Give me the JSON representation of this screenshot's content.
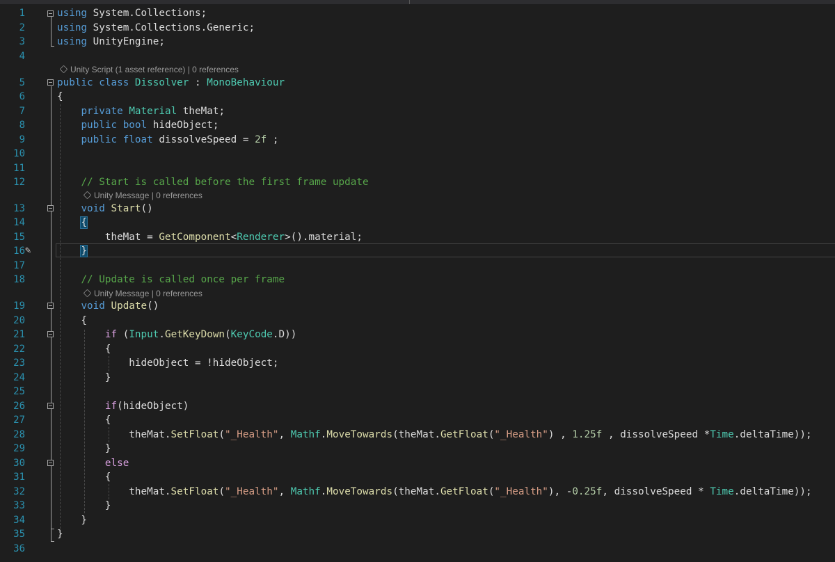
{
  "line_numbers": [
    "1",
    "2",
    "3",
    "4",
    "5",
    "6",
    "7",
    "8",
    "9",
    "10",
    "11",
    "12",
    "13",
    "14",
    "15",
    "16",
    "17",
    "18",
    "19",
    "20",
    "21",
    "22",
    "23",
    "24",
    "25",
    "26",
    "27",
    "28",
    "29",
    "30",
    "31",
    "32",
    "33",
    "34",
    "35",
    "36"
  ],
  "code_lens": {
    "class": "Unity Script (1 asset reference) | 0 references",
    "start": "Unity Message | 0 references",
    "update": "Unity Message | 0 references"
  },
  "current_line": "16",
  "colors": {
    "background": "#1e1e1e",
    "keyword": "#569cd6",
    "control_keyword": "#d8a0df",
    "type": "#4ec9b0",
    "method": "#dcdcaa",
    "string": "#d69d85",
    "number": "#b5cea8",
    "comment": "#57a64a",
    "line_number": "#2b91af"
  },
  "icons": {
    "edit_marker": "pencil-icon",
    "code_lens": "unity-cube-icon",
    "fold": "collapse-minus-icon"
  },
  "code": {
    "l1": [
      {
        "t": "using",
        "c": "kw"
      },
      {
        "t": " System.Collections;"
      }
    ],
    "l2": [
      {
        "t": "using",
        "c": "kw"
      },
      {
        "t": " System.Collections.Generic;"
      }
    ],
    "l3": [
      {
        "t": "using",
        "c": "kw"
      },
      {
        "t": " UnityEngine;"
      }
    ],
    "l5": [
      {
        "t": "public",
        "c": "kw"
      },
      {
        "t": " "
      },
      {
        "t": "class",
        "c": "kw"
      },
      {
        "t": " "
      },
      {
        "t": "Dissolver",
        "c": "ty"
      },
      {
        "t": " : "
      },
      {
        "t": "MonoBehaviour",
        "c": "ty"
      }
    ],
    "l6": [
      {
        "t": "{"
      }
    ],
    "l7": [
      {
        "t": "    "
      },
      {
        "t": "private",
        "c": "kw"
      },
      {
        "t": " "
      },
      {
        "t": "Material",
        "c": "ty"
      },
      {
        "t": " theMat;"
      }
    ],
    "l8": [
      {
        "t": "    "
      },
      {
        "t": "public",
        "c": "kw"
      },
      {
        "t": " "
      },
      {
        "t": "bool",
        "c": "kw"
      },
      {
        "t": " hideObject;"
      }
    ],
    "l9": [
      {
        "t": "    "
      },
      {
        "t": "public",
        "c": "kw"
      },
      {
        "t": " "
      },
      {
        "t": "float",
        "c": "kw"
      },
      {
        "t": " dissolveSpeed = "
      },
      {
        "t": "2f",
        "c": "num"
      },
      {
        "t": " ;"
      }
    ],
    "l12": [
      {
        "t": "    "
      },
      {
        "t": "// Start is called before the first frame update",
        "c": "cm"
      }
    ],
    "l13": [
      {
        "t": "    "
      },
      {
        "t": "void",
        "c": "kw"
      },
      {
        "t": " "
      },
      {
        "t": "Start",
        "c": "fn"
      },
      {
        "t": "()"
      }
    ],
    "l14": [
      {
        "t": "    "
      },
      {
        "t": "{",
        "c": "brace-hl"
      }
    ],
    "l15": [
      {
        "t": "        theMat = "
      },
      {
        "t": "GetComponent",
        "c": "fn"
      },
      {
        "t": "<"
      },
      {
        "t": "Renderer",
        "c": "ty"
      },
      {
        "t": ">().material;"
      }
    ],
    "l16": [
      {
        "t": "    "
      },
      {
        "t": "}",
        "c": "brace-hl"
      }
    ],
    "l18": [
      {
        "t": "    "
      },
      {
        "t": "// Update is called once per frame",
        "c": "cm"
      }
    ],
    "l19": [
      {
        "t": "    "
      },
      {
        "t": "void",
        "c": "kw"
      },
      {
        "t": " "
      },
      {
        "t": "Update",
        "c": "fn"
      },
      {
        "t": "()"
      }
    ],
    "l20": [
      {
        "t": "    {"
      }
    ],
    "l21": [
      {
        "t": "        "
      },
      {
        "t": "if",
        "c": "ctl"
      },
      {
        "t": " ("
      },
      {
        "t": "Input",
        "c": "ty"
      },
      {
        "t": "."
      },
      {
        "t": "GetKeyDown",
        "c": "fn"
      },
      {
        "t": "("
      },
      {
        "t": "KeyCode",
        "c": "ty"
      },
      {
        "t": ".D))"
      }
    ],
    "l22": [
      {
        "t": "        {"
      }
    ],
    "l23": [
      {
        "t": "            hideObject = !hideObject;"
      }
    ],
    "l24": [
      {
        "t": "        }"
      }
    ],
    "l26": [
      {
        "t": "        "
      },
      {
        "t": "if",
        "c": "ctl"
      },
      {
        "t": "(hideObject)"
      }
    ],
    "l27": [
      {
        "t": "        {"
      }
    ],
    "l28": [
      {
        "t": "            theMat."
      },
      {
        "t": "SetFloat",
        "c": "fn"
      },
      {
        "t": "("
      },
      {
        "t": "\"_Health\"",
        "c": "str"
      },
      {
        "t": ", "
      },
      {
        "t": "Mathf",
        "c": "ty"
      },
      {
        "t": "."
      },
      {
        "t": "MoveTowards",
        "c": "fn"
      },
      {
        "t": "(theMat."
      },
      {
        "t": "GetFloat",
        "c": "fn"
      },
      {
        "t": "("
      },
      {
        "t": "\"_Health\"",
        "c": "str"
      },
      {
        "t": ") , "
      },
      {
        "t": "1.25f",
        "c": "num"
      },
      {
        "t": " , dissolveSpeed *"
      },
      {
        "t": "Time",
        "c": "ty"
      },
      {
        "t": ".deltaTime));"
      }
    ],
    "l29": [
      {
        "t": "        }"
      }
    ],
    "l30": [
      {
        "t": "        "
      },
      {
        "t": "else",
        "c": "ctl"
      }
    ],
    "l31": [
      {
        "t": "        {"
      }
    ],
    "l32": [
      {
        "t": "            theMat."
      },
      {
        "t": "SetFloat",
        "c": "fn"
      },
      {
        "t": "("
      },
      {
        "t": "\"_Health\"",
        "c": "str"
      },
      {
        "t": ", "
      },
      {
        "t": "Mathf",
        "c": "ty"
      },
      {
        "t": "."
      },
      {
        "t": "MoveTowards",
        "c": "fn"
      },
      {
        "t": "(theMat."
      },
      {
        "t": "GetFloat",
        "c": "fn"
      },
      {
        "t": "("
      },
      {
        "t": "\"_Health\"",
        "c": "str"
      },
      {
        "t": "), -"
      },
      {
        "t": "0.25f",
        "c": "num"
      },
      {
        "t": ", dissolveSpeed * "
      },
      {
        "t": "Time",
        "c": "ty"
      },
      {
        "t": ".deltaTime));"
      }
    ],
    "l33": [
      {
        "t": "        }"
      }
    ],
    "l34": [
      {
        "t": "    }"
      }
    ],
    "l35": [
      {
        "t": "}"
      }
    ]
  }
}
